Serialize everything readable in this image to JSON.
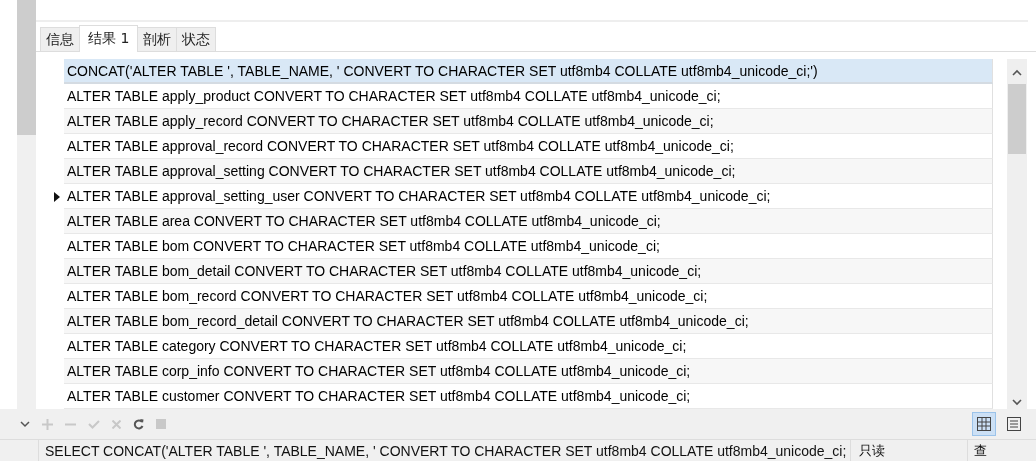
{
  "tabs": [
    {
      "label": "信息",
      "selected": false
    },
    {
      "label": "结果 1",
      "selected": true
    },
    {
      "label": "剖析",
      "selected": false
    },
    {
      "label": "状态",
      "selected": false
    }
  ],
  "table": {
    "columns": [
      "CONCAT('ALTER TABLE ', TABLE_NAME, ' CONVERT TO CHARACTER SET utf8mb4 COLLATE utf8mb4_unicode_ci;')"
    ],
    "rows": [
      {
        "text": "ALTER TABLE apply_product CONVERT TO CHARACTER SET utf8mb4 COLLATE utf8mb4_unicode_ci;",
        "selected": false
      },
      {
        "text": "ALTER TABLE apply_record CONVERT TO CHARACTER SET utf8mb4 COLLATE utf8mb4_unicode_ci;",
        "selected": false
      },
      {
        "text": "ALTER TABLE approval_record CONVERT TO CHARACTER SET utf8mb4 COLLATE utf8mb4_unicode_ci;",
        "selected": false
      },
      {
        "text": "ALTER TABLE approval_setting CONVERT TO CHARACTER SET utf8mb4 COLLATE utf8mb4_unicode_ci;",
        "selected": false
      },
      {
        "text": "ALTER TABLE approval_setting_user CONVERT TO CHARACTER SET utf8mb4 COLLATE utf8mb4_unicode_ci;",
        "selected": true
      },
      {
        "text": "ALTER TABLE area CONVERT TO CHARACTER SET utf8mb4 COLLATE utf8mb4_unicode_ci;",
        "selected": false
      },
      {
        "text": "ALTER TABLE bom CONVERT TO CHARACTER SET utf8mb4 COLLATE utf8mb4_unicode_ci;",
        "selected": false
      },
      {
        "text": "ALTER TABLE bom_detail CONVERT TO CHARACTER SET utf8mb4 COLLATE utf8mb4_unicode_ci;",
        "selected": false
      },
      {
        "text": "ALTER TABLE bom_record CONVERT TO CHARACTER SET utf8mb4 COLLATE utf8mb4_unicode_ci;",
        "selected": false
      },
      {
        "text": "ALTER TABLE bom_record_detail CONVERT TO CHARACTER SET utf8mb4 COLLATE utf8mb4_unicode_ci;",
        "selected": false
      },
      {
        "text": "ALTER TABLE category CONVERT TO CHARACTER SET utf8mb4 COLLATE utf8mb4_unicode_ci;",
        "selected": false
      },
      {
        "text": "ALTER TABLE corp_info CONVERT TO CHARACTER SET utf8mb4 COLLATE utf8mb4_unicode_ci;",
        "selected": false
      },
      {
        "text": "ALTER TABLE customer CONVERT TO CHARACTER SET utf8mb4 COLLATE utf8mb4_unicode_ci;",
        "selected": false
      }
    ]
  },
  "view_buttons": [
    {
      "kind": "grid",
      "selected": true
    },
    {
      "kind": "form",
      "selected": false
    }
  ],
  "status_bar": {
    "query": "SELECT CONCAT('ALTER TABLE ', TABLE_NAME, ' CONVERT TO CHARACTER SET utf8mb4 COLLATE utf8mb4_unicode_ci;",
    "mode": "只读",
    "extra": "查"
  }
}
